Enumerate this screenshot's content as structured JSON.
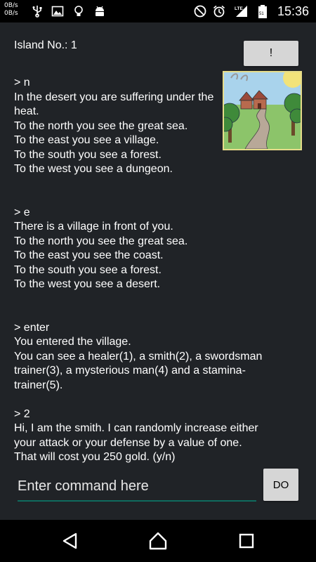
{
  "status_bar": {
    "net_up": "0B/s",
    "net_down": "0B/s",
    "left_icons": [
      "usb-icon",
      "image-icon",
      "lightbulb-icon",
      "android-icon"
    ],
    "right_icons": [
      "do-not-disturb-icon",
      "alarm-icon",
      "lte-signal-icon",
      "battery-icon"
    ],
    "network_type": "LTE",
    "battery_level": "51",
    "time": "15:36"
  },
  "header": {
    "island_label": "Island No.: 1",
    "alert_button_label": "!"
  },
  "log": {
    "entry1": {
      "command": "> n",
      "lines": [
        "In the desert you are suffering under the",
        "heat.",
        "To the north you see the great sea.",
        "To the east you see a village.",
        "To the south you see a forest.",
        "To the west you see a dungeon."
      ]
    },
    "entry2": {
      "command": "> e",
      "lines": [
        "There is a village in front of you.",
        "To the north you see the great sea.",
        "To the east you see the coast.",
        "To the south you see a forest.",
        "To the west you see a desert."
      ]
    },
    "entry3": {
      "command": "> enter",
      "lines": [
        "You entered the village.",
        "You can see a healer(1), a smith(2), a swordsman",
        "trainer(3), a mysterious man(4) and a stamina-",
        "trainer(5)."
      ]
    },
    "entry4": {
      "command": "> 2",
      "lines": [
        "Hi, I am the smith. I can randomly increase either",
        "your attack or your defense by a value of one.",
        "That will cost you 250 gold. (y/n)"
      ]
    }
  },
  "command": {
    "placeholder": "Enter command here",
    "value": "",
    "do_button_label": "DO"
  },
  "nav": {
    "icons": [
      "back-icon",
      "home-icon",
      "recents-icon"
    ]
  },
  "colors": {
    "app_background": "#202327",
    "button_background": "#d6d6d6",
    "input_underline": "#0f6b5e",
    "scene_border": "#e6dc8a"
  }
}
